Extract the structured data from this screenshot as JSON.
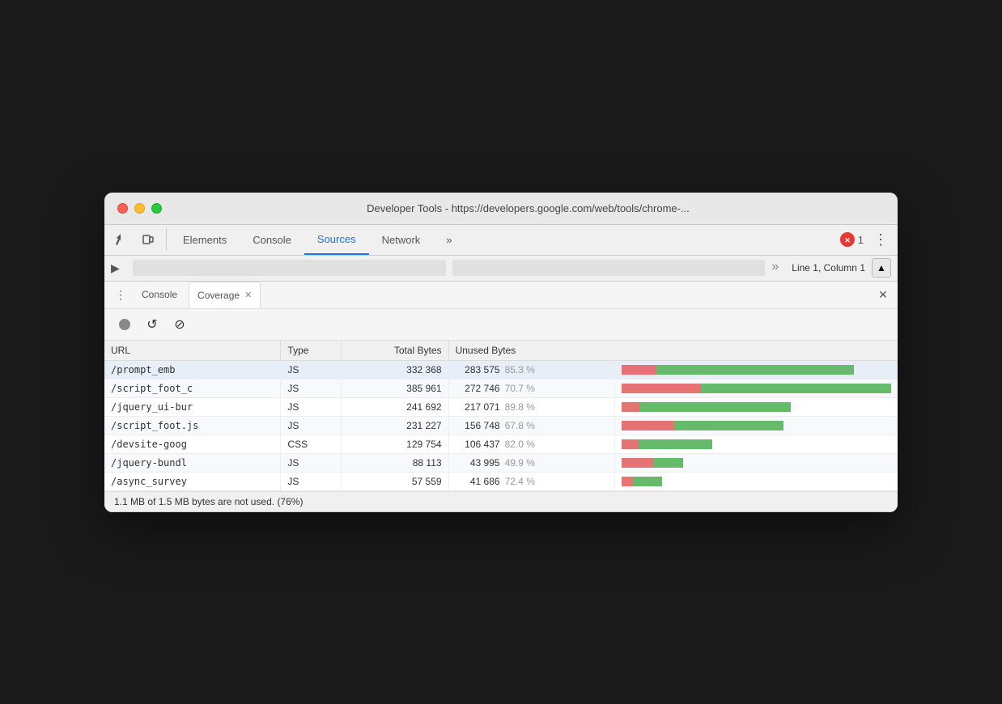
{
  "window": {
    "title": "Developer Tools - https://developers.google.com/web/tools/chrome-..."
  },
  "toolbar": {
    "tabs": [
      {
        "label": "Elements",
        "active": false
      },
      {
        "label": "Console",
        "active": false
      },
      {
        "label": "Sources",
        "active": true
      },
      {
        "label": "Network",
        "active": false
      },
      {
        "label": "»",
        "active": false
      }
    ],
    "error_count": "1",
    "more_label": "⋮"
  },
  "secondary": {
    "position": "Line 1, Column 1"
  },
  "drawer": {
    "tabs": [
      {
        "label": "Console",
        "active": false,
        "closable": false
      },
      {
        "label": "Coverage",
        "active": true,
        "closable": true
      }
    ]
  },
  "coverage": {
    "record_btn": "●",
    "reload_btn": "↺",
    "clear_btn": "⊘",
    "table": {
      "headers": [
        "URL",
        "Type",
        "Total Bytes",
        "Unused Bytes",
        ""
      ],
      "rows": [
        {
          "url": "/prompt_emb",
          "type": "JS",
          "total": "332 368",
          "unused": "283 575",
          "unused_pct": "85.3 %",
          "used_ratio": 0.147,
          "unused_ratio": 0.853
        },
        {
          "url": "/script_foot_c",
          "type": "JS",
          "total": "385 961",
          "unused": "272 746",
          "unused_pct": "70.7 %",
          "used_ratio": 0.293,
          "unused_ratio": 0.707
        },
        {
          "url": "/jquery_ui-bur",
          "type": "JS",
          "total": "241 692",
          "unused": "217 071",
          "unused_pct": "89.8 %",
          "used_ratio": 0.102,
          "unused_ratio": 0.898
        },
        {
          "url": "/script_foot.js",
          "type": "JS",
          "total": "231 227",
          "unused": "156 748",
          "unused_pct": "67.8 %",
          "used_ratio": 0.322,
          "unused_ratio": 0.678
        },
        {
          "url": "/devsite-goog",
          "type": "CSS",
          "total": "129 754",
          "unused": "106 437",
          "unused_pct": "82.0 %",
          "used_ratio": 0.18,
          "unused_ratio": 0.82
        },
        {
          "url": "/jquery-bundl",
          "type": "JS",
          "total": "88 113",
          "unused": "43 995",
          "unused_pct": "49.9 %",
          "used_ratio": 0.501,
          "unused_ratio": 0.499
        },
        {
          "url": "/async_survey",
          "type": "JS",
          "total": "57 559",
          "unused": "41 686",
          "unused_pct": "72.4 %",
          "used_ratio": 0.276,
          "unused_ratio": 0.724
        }
      ]
    },
    "status": "1.1 MB of 1.5 MB bytes are not used. (76%)"
  }
}
